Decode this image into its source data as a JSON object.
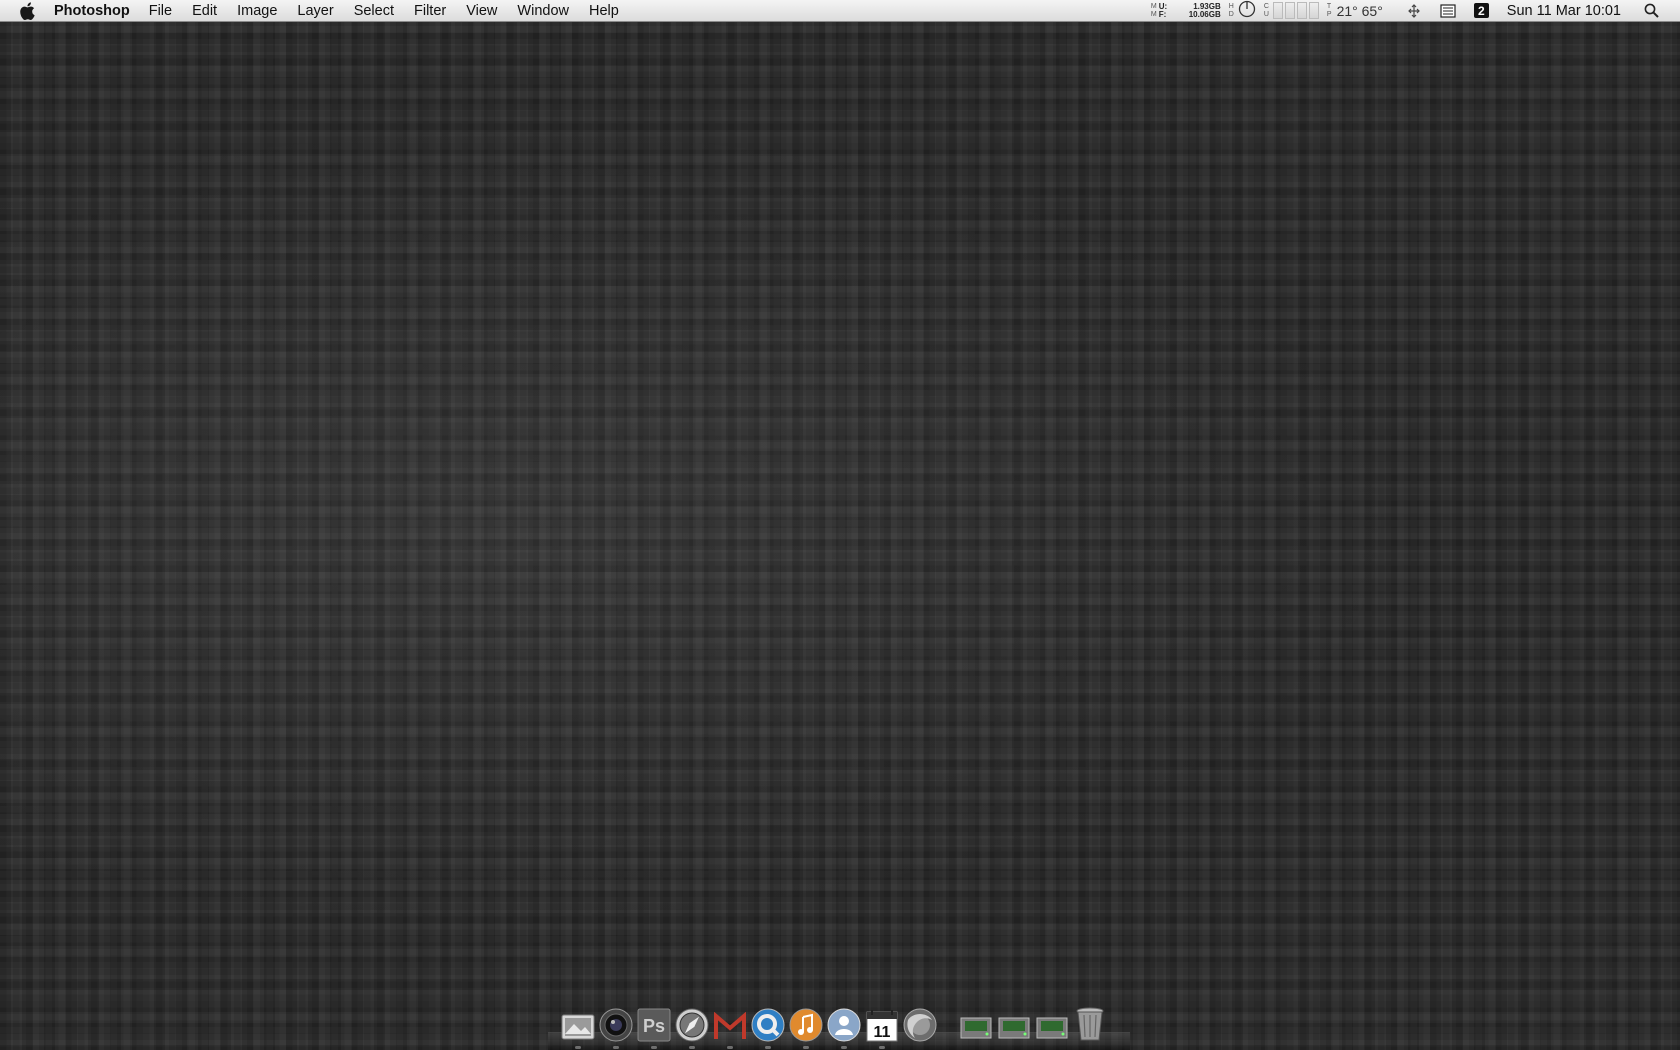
{
  "menubar": {
    "app_name": "Photoshop",
    "menus": [
      "File",
      "Edit",
      "Image",
      "Layer",
      "Select",
      "Filter",
      "View",
      "Window",
      "Help"
    ],
    "memory": {
      "used_label": "U:",
      "used_value": "1.93GB",
      "free_label": "F:",
      "free_value": "10.06GB"
    },
    "temperature": "21° 65°",
    "date_time": "Sun 11 Mar  10:01",
    "spaces_number": "2"
  },
  "dock": {
    "items": [
      {
        "name": "preview-app",
        "icon": "photo-viewer-icon"
      },
      {
        "name": "photo-booth",
        "icon": "camera-lens-icon"
      },
      {
        "name": "photoshop",
        "icon": "photoshop-icon",
        "label": "Ps"
      },
      {
        "name": "safari",
        "icon": "compass-icon"
      },
      {
        "name": "gmail",
        "icon": "gmail-icon"
      },
      {
        "name": "quicktime",
        "icon": "quicktime-icon"
      },
      {
        "name": "itunes",
        "icon": "itunes-icon"
      },
      {
        "name": "address-book",
        "icon": "contacts-icon"
      },
      {
        "name": "ical",
        "icon": "calendar-icon",
        "label": "11"
      },
      {
        "name": "firefox",
        "icon": "globe-icon"
      },
      {
        "name": "disk-1",
        "icon": "hard-drive-icon"
      },
      {
        "name": "disk-2",
        "icon": "hard-drive-icon"
      },
      {
        "name": "disk-3",
        "icon": "hard-drive-icon"
      },
      {
        "name": "trash",
        "icon": "trash-icon"
      }
    ]
  },
  "colors": {
    "menubar_top": "#f4f4f4",
    "menubar_bottom": "#dcdcdc",
    "desktop": "#2b2b2b"
  }
}
